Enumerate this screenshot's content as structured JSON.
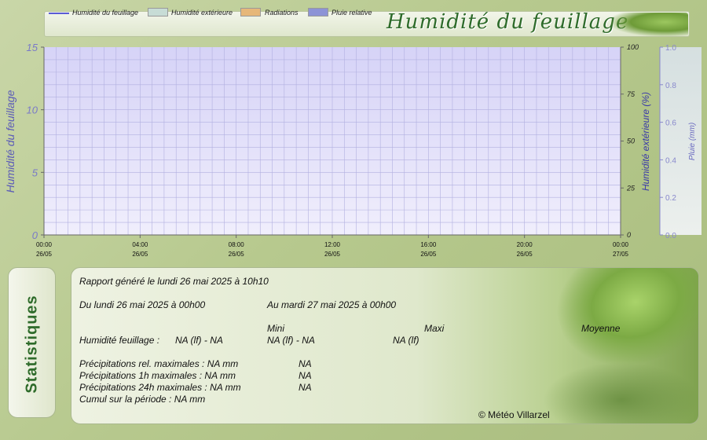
{
  "legend": {
    "items": [
      {
        "label": "Humidité du feuillage",
        "kind": "line",
        "color": "#5b5bd6"
      },
      {
        "label": "Humidité extérieure",
        "kind": "box",
        "color": "#c7dcd6"
      },
      {
        "label": "Radiations",
        "kind": "box",
        "color": "#e6b77a"
      },
      {
        "label": "Pluie relative",
        "kind": "box",
        "color": "#8d93d6"
      }
    ]
  },
  "title": "Humidité du feuillage",
  "chart_data": {
    "type": "line",
    "ylabel": "Humidité du feuillage",
    "y2label": "Humidité extérieure (%)",
    "y3label": "Pluie (mm)",
    "ylim": [
      0,
      15
    ],
    "y2lim": [
      0,
      100
    ],
    "y3lim": [
      0,
      1
    ],
    "y_ticks": [
      "0",
      "5",
      "10",
      "15"
    ],
    "y2_ticks": [
      "0",
      "25",
      "50",
      "75",
      "100"
    ],
    "y3_ticks": [
      "0.0",
      "0.2",
      "0.4",
      "0.6",
      "0.8",
      "1.0"
    ],
    "x_ticks": [
      {
        "time": "00:00",
        "date": "26/05"
      },
      {
        "time": "04:00",
        "date": "26/05"
      },
      {
        "time": "08:00",
        "date": "26/05"
      },
      {
        "time": "12:00",
        "date": "26/05"
      },
      {
        "time": "16:00",
        "date": "26/05"
      },
      {
        "time": "20:00",
        "date": "26/05"
      },
      {
        "time": "00:00",
        "date": "27/05"
      }
    ],
    "grid": true,
    "series": []
  },
  "stats": {
    "tab_label": "Statistiques",
    "generated": "Rapport généré le lundi 26 mai 2025 à 10h10",
    "period_from": "Du lundi 26 mai 2025 à 00h00",
    "period_to": "Au mardi 27 mai 2025 à 00h00",
    "col_min": "Mini",
    "col_max": "Maxi",
    "col_avg": "Moyenne",
    "humidity_label": "Humidité feuillage :",
    "humidity_min": "NA (lf) - NA",
    "humidity_max": "NA (lf) - NA",
    "humidity_avg": "NA (lf)",
    "precip_rel_label": "Précipitations rel. maximales : NA mm",
    "precip_rel_val": "NA",
    "precip_1h_label": "Précipitations 1h maximales : NA mm",
    "precip_1h_val": "NA",
    "precip_24h_label": "Précipitations 24h maximales : NA mm",
    "precip_24h_val": "NA",
    "cumul_label": "Cumul sur la période : NA mm",
    "copyright": "© Météo Villarzel"
  }
}
